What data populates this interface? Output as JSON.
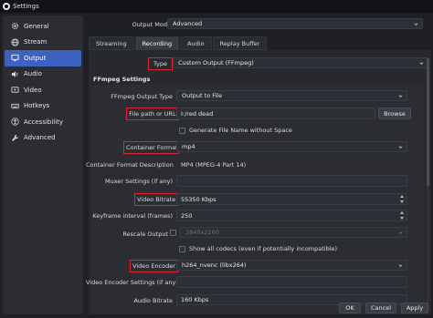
{
  "window": {
    "title": "Settings"
  },
  "sidebar": {
    "items": [
      {
        "label": "General",
        "icon": "gear-icon"
      },
      {
        "label": "Stream",
        "icon": "globe-icon"
      },
      {
        "label": "Output",
        "icon": "monitor-icon",
        "active": true
      },
      {
        "label": "Audio",
        "icon": "speaker-icon"
      },
      {
        "label": "Video",
        "icon": "video-icon"
      },
      {
        "label": "Hotkeys",
        "icon": "keyboard-icon"
      },
      {
        "label": "Accessibility",
        "icon": "accessibility-icon"
      },
      {
        "label": "Advanced",
        "icon": "wrench-icon"
      }
    ]
  },
  "output_mode": {
    "label": "Output Mode",
    "value": "Advanced"
  },
  "tabs": [
    {
      "label": "Streaming"
    },
    {
      "label": "Recording",
      "active": true
    },
    {
      "label": "Audio"
    },
    {
      "label": "Replay Buffer"
    }
  ],
  "type": {
    "label": "Type",
    "value": "Custom Output (FFmpeg)"
  },
  "ffmpeg": {
    "title": "FFmpeg Settings",
    "output_type": {
      "label": "FFmpeg Output Type",
      "value": "Output to File"
    },
    "file_path": {
      "label": "File path or URL",
      "value": "I:/red dead",
      "browse": "Browse"
    },
    "gen_name": {
      "label": "Generate File Name without Space"
    },
    "container_format": {
      "label": "Container Format",
      "value": "mp4"
    },
    "container_desc": {
      "label": "Container Format Description",
      "value": "MP4 (MPEG-4 Part 14)"
    },
    "muxer": {
      "label": "Muxer Settings (if any)",
      "value": ""
    },
    "video_bitrate": {
      "label": "Video Bitrate",
      "value": "55350 Kbps"
    },
    "keyframe": {
      "label": "Keyframe interval (frames)",
      "value": "250"
    },
    "rescale": {
      "label": "Rescale Output",
      "value": "3840x2160"
    },
    "show_codecs": {
      "label": "Show all codecs (even if potentially incompatible)"
    },
    "video_encoder": {
      "label": "Video Encoder",
      "value": "h264_nvenc (libx264)"
    },
    "encoder_settings": {
      "label": "Video Encoder Settings (if any)",
      "value": ""
    },
    "audio_bitrate": {
      "label": "Audio Bitrate",
      "value": "160 Kbps"
    }
  },
  "footer": {
    "ok": "OK",
    "cancel": "Cancel",
    "apply": "Apply"
  },
  "colors": {
    "accent": "#3d62c2",
    "highlight": "#e0242b",
    "background": "#1f2026"
  }
}
